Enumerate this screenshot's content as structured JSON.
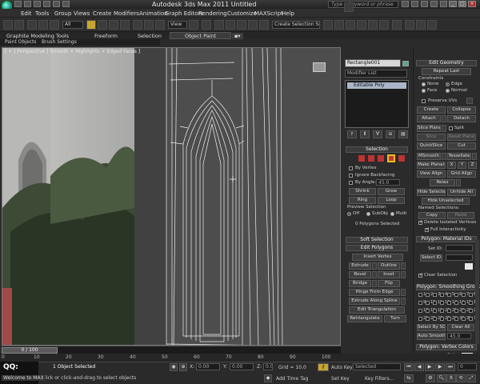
{
  "window": {
    "title": "Autodesk 3ds Max  2011     Untitled",
    "search_placeholder": "Type a keyword or phrase"
  },
  "menu": [
    "Edit",
    "Tools",
    "Group",
    "Views",
    "Create",
    "Modifiers",
    "Animation",
    "Graph Editors",
    "Rendering",
    "Customize",
    "MAXScript",
    "Help"
  ],
  "toolbar": {
    "selection_filter": "All",
    "view_dropdown": "View",
    "named_selection": "Create Selection Se"
  },
  "ribbon": {
    "tabs": [
      "Graphite Modeling Tools",
      "Freeform",
      "Selection",
      "Object Paint"
    ],
    "subtabs": [
      "Paint Objects",
      "Brush Settings"
    ]
  },
  "viewport": {
    "label": "[ + ] Perspective ] Smooth + Highlights + Edged Faces ]"
  },
  "command_panel": {
    "object_name": "Rectangle001",
    "modifier_list": "Modifier List",
    "stack_item": "Editable Poly",
    "selection": {
      "header": "Selection",
      "by_vertex": "By Vertex",
      "ignore_backfacing": "Ignore Backfacing",
      "by_angle": "By Angle:",
      "by_angle_value": "45.0",
      "shrink": "Shrink",
      "grow": "Grow",
      "ring": "Ring",
      "loop": "Loop",
      "preview_header": "Preview Selection",
      "preview_off": "Off",
      "preview_subobj": "SubObj",
      "preview_multi": "Multi",
      "status": "0 Polygons Selected"
    },
    "soft_selection": "Soft Selection",
    "edit_polygons": {
      "header": "Edit Polygons",
      "insert_vertex": "Insert Vertex",
      "extrude": "Extrude",
      "outline": "Outline",
      "bevel": "Bevel",
      "inset": "Inset",
      "bridge": "Bridge",
      "flip": "Flip",
      "hinge": "Hinge From Edge",
      "extrude_spline": "Extrude Along Spline",
      "edit_triangulation": "Edit Triangulation",
      "retriangulate": "Retriangulate",
      "turn": "Turn"
    }
  },
  "edit_geometry": {
    "header": "Edit Geometry",
    "repeat_last": "Repeat Last",
    "constraints": "Constraints",
    "none": "None",
    "edge": "Edge",
    "face": "Face",
    "normal": "Normal",
    "preserve_uvs": "Preserve UVs",
    "create": "Create",
    "collapse": "Collapse",
    "attach": "Attach",
    "detach": "Detach",
    "slice_plane": "Slice Plane",
    "split": "Split",
    "slice": "Slice",
    "reset_plane": "Reset Plane",
    "quickslice": "QuickSlice",
    "cut": "Cut",
    "msmooth": "MSmooth",
    "tessellate": "Tessellate",
    "make_planar": "Make Planar",
    "x": "X",
    "y": "Y",
    "z": "Z",
    "view_align": "View Align",
    "grid_align": "Grid Align",
    "relax": "Relax",
    "hide_selected": "Hide Selected",
    "unhide_all": "Unhide All",
    "hide_unselected": "Hide Unselected",
    "named_selections": "Named Selections:",
    "copy": "Copy",
    "paste": "Paste",
    "delete_isolated": "Delete Isolated Vertices",
    "full_interactivity": "Full Interactivity"
  },
  "material_ids": {
    "header": "Polygon: Material IDs",
    "set_id": "Set ID:",
    "select_id": "Select ID",
    "clear_selection": "Clear Selection"
  },
  "smoothing_groups": {
    "header": "Polygon: Smoothing Groups",
    "numbers": [
      "1",
      "2",
      "3",
      "4",
      "5",
      "6",
      "7",
      "8",
      "9",
      "10",
      "11",
      "12",
      "13",
      "14",
      "15",
      "16",
      "17",
      "18",
      "19",
      "20",
      "21",
      "22",
      "23",
      "24",
      "25",
      "26",
      "27",
      "28",
      "29",
      "30",
      "31",
      "32"
    ],
    "select_by_sg": "Select By SG",
    "clear_all": "Clear All",
    "auto_smooth": "Auto Smooth",
    "auto_smooth_value": "45.0"
  },
  "vertex_colors": {
    "header": "Polygon: Vertex Colors",
    "color": "Color:"
  },
  "timeline": {
    "frame": "0 / 100",
    "ticks": [
      "0",
      "10",
      "20",
      "30",
      "40",
      "50",
      "60",
      "70",
      "80",
      "90",
      "100"
    ]
  },
  "status": {
    "qq": "QQ:",
    "welcome": "Welcome to MAX",
    "objects_selected": "1 Object Selected",
    "prompt": "Click or click-and-drag to select objects",
    "x_label": "X:",
    "x_value": "0.00",
    "y_label": "Y:",
    "y_value": "0.00",
    "z_label": "Z:",
    "z_value": "0.00",
    "grid": "Grid = 10.0",
    "auto_key": "Auto Key",
    "auto_key_value": "Selected",
    "set_key": "Set Key",
    "key_filters": "Key Filters...",
    "add_time_tag": "Add Time Tag",
    "frame_value": "0"
  }
}
